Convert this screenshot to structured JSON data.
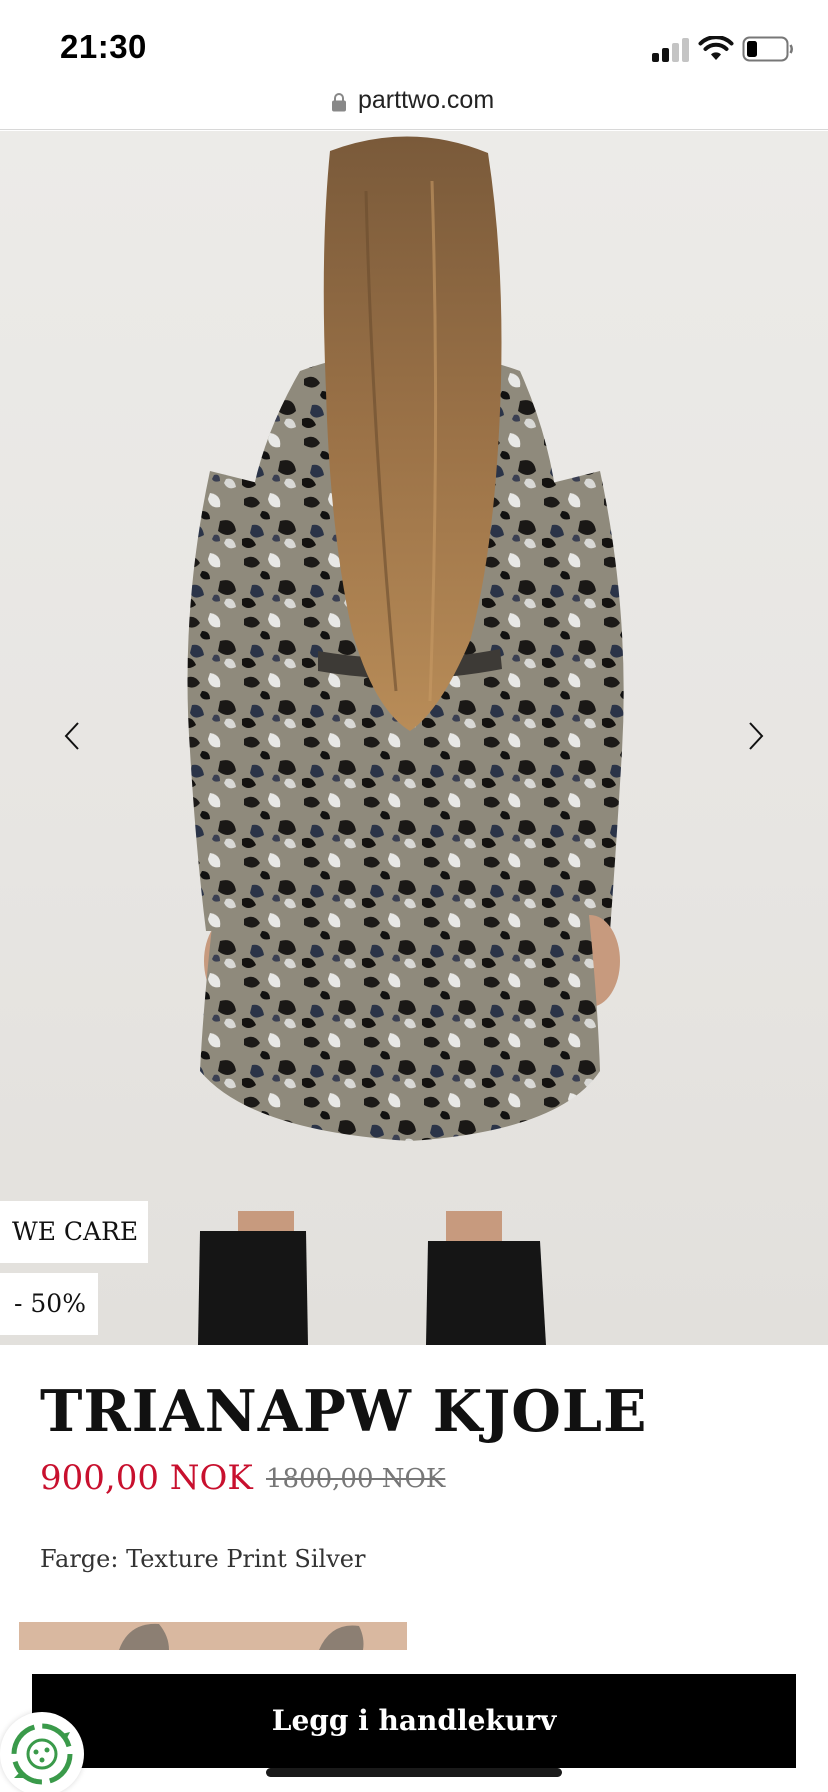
{
  "status_bar": {
    "time": "21:30"
  },
  "browser": {
    "url": "parttwo.com"
  },
  "gallery": {
    "prev_icon": "chevron-left-icon",
    "next_icon": "chevron-right-icon",
    "badges": {
      "we_care": "WE CARE",
      "discount": "- 50%"
    }
  },
  "product": {
    "title": "TRIANAPW KJOLE",
    "sale_price": "900,00 NOK",
    "original_price": "1800,00 NOK",
    "color_label": "Farge: Texture Print Silver"
  },
  "cart": {
    "button_label": "Legg i handlekurv"
  },
  "colors": {
    "sale_price": "#c8102e",
    "button_bg": "#000000",
    "swatch": "#d9b8a0",
    "eco_green": "#3a9a4a"
  }
}
